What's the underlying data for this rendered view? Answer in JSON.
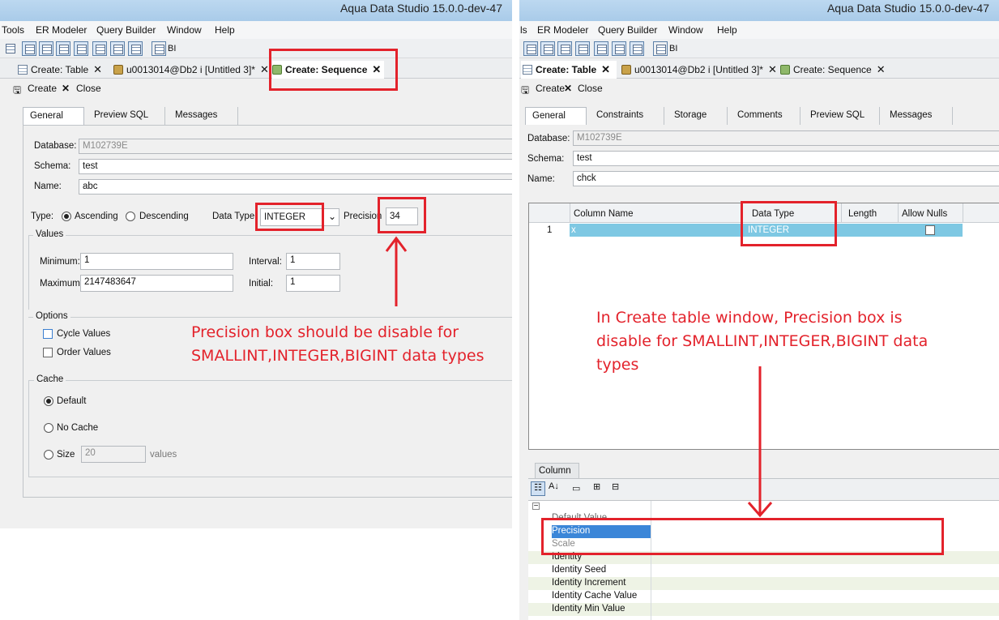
{
  "app_title": "Aqua Data Studio 15.0.0-dev-47",
  "left": {
    "menu": [
      "Tools",
      "ER Modeler",
      "Query Builder",
      "Window",
      "Help"
    ],
    "toolbar_bi": "BI",
    "tabs": [
      {
        "label": "Create: Table"
      },
      {
        "label": "u0013014@Db2 i [Untitled 3]*"
      },
      {
        "label": "Create: Sequence"
      }
    ],
    "actions": {
      "create": "Create",
      "close": "Close"
    },
    "subtabs": [
      "General",
      "Preview SQL",
      "Messages"
    ],
    "form": {
      "database_label": "Database:",
      "database": "M102739E",
      "schema_label": "Schema:",
      "schema": "test",
      "name_label": "Name:",
      "name": "abc",
      "type_label": "Type:",
      "ascending": "Ascending",
      "descending": "Descending",
      "datatype_label": "Data Type:",
      "datatype": "INTEGER",
      "precision_label": "Precision",
      "precision": "34",
      "values_group": "Values",
      "minimum_label": "Minimum:",
      "minimum": "1",
      "maximum_label": "Maximum:",
      "maximum": "2147483647",
      "interval_label": "Interval:",
      "interval": "1",
      "initial_label": "Initial:",
      "initial": "1",
      "options_group": "Options",
      "cycle_values": "Cycle Values",
      "order_values": "Order Values",
      "cache_group": "Cache",
      "cache_default": "Default",
      "cache_none": "No Cache",
      "cache_size": "Size",
      "cache_size_value": "20",
      "cache_values": "values"
    },
    "annotation": [
      "Precision box should be disable for",
      "SMALLINT,INTEGER,BIGINT data types"
    ]
  },
  "right": {
    "menu": [
      "ls",
      "ER Modeler",
      "Query Builder",
      "Window",
      "Help"
    ],
    "toolbar_bi": "BI",
    "tabs": [
      {
        "label": "Create: Table"
      },
      {
        "label": "u0013014@Db2 i [Untitled 3]*"
      },
      {
        "label": "Create: Sequence"
      }
    ],
    "actions": {
      "create": "Create",
      "close": "Close"
    },
    "subtabs": [
      "General",
      "Constraints",
      "Storage",
      "Comments",
      "Preview SQL",
      "Messages"
    ],
    "form": {
      "database_label": "Database:",
      "database": "M102739E",
      "schema_label": "Schema:",
      "schema": "test",
      "name_label": "Name:",
      "name": "chck"
    },
    "grid": {
      "headers": [
        "Column Name",
        "Data Type",
        "Length",
        "Allow Nulls"
      ],
      "row_num": "1",
      "col_name": "x",
      "data_type": "INTEGER"
    },
    "column_tab": "Column",
    "properties": [
      "Default Value",
      "Precision",
      "Scale",
      "Identity",
      "Identity Seed",
      "Identity Increment",
      "Identity Cache Value",
      "Identity Min Value"
    ],
    "annotation": [
      "In Create table window, Precision box is",
      "disable for SMALLINT,INTEGER,BIGINT data",
      "types"
    ]
  }
}
